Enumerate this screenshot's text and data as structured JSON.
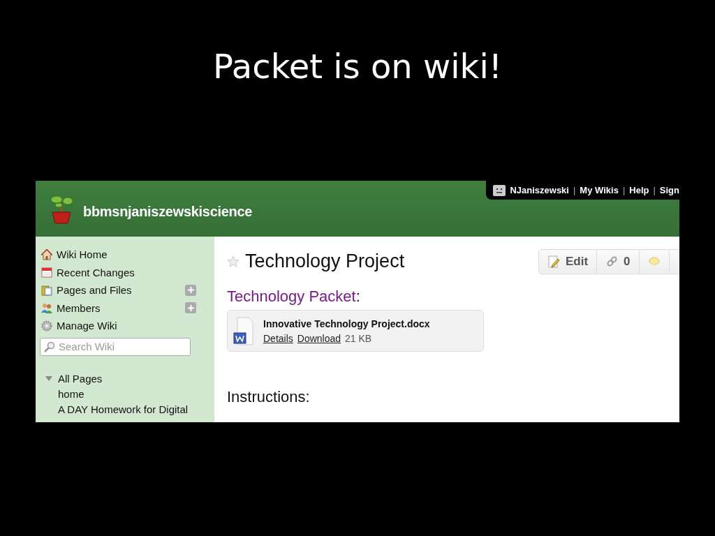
{
  "slide": {
    "title": "Packet is on wiki!"
  },
  "wiki": {
    "name": "bbmsnjaniszewskiscience",
    "user_links": [
      "NJaniszewski",
      "My Wikis",
      "Help",
      "Sign"
    ],
    "link_separator": "|",
    "nav": [
      {
        "label": "Wiki Home",
        "kind": "home",
        "expandable": false
      },
      {
        "label": "Recent Changes",
        "kind": "calendar",
        "expandable": false
      },
      {
        "label": "Pages and Files",
        "kind": "pages",
        "expandable": true
      },
      {
        "label": "Members",
        "kind": "members",
        "expandable": true
      },
      {
        "label": "Manage Wiki",
        "kind": "gear",
        "expandable": false
      }
    ],
    "search": {
      "placeholder": "Search Wiki"
    },
    "tree": [
      {
        "label": "All Pages",
        "expanded": true,
        "children": [
          {
            "label": "home"
          },
          {
            "label": "A DAY Homework for Digital"
          }
        ]
      }
    ]
  },
  "page": {
    "title": "Technology Project",
    "starred": false,
    "actions": [
      {
        "kind": "edit",
        "label": "Edit"
      },
      {
        "kind": "links",
        "label": "0"
      },
      {
        "kind": "comments"
      }
    ],
    "link": "Technology Packet",
    "link_suffix": ":",
    "file": {
      "name": "Innovative Technology Project.docx",
      "links": [
        "Details",
        "Download"
      ],
      "size": "21 KB"
    },
    "section": "Instructions:"
  }
}
